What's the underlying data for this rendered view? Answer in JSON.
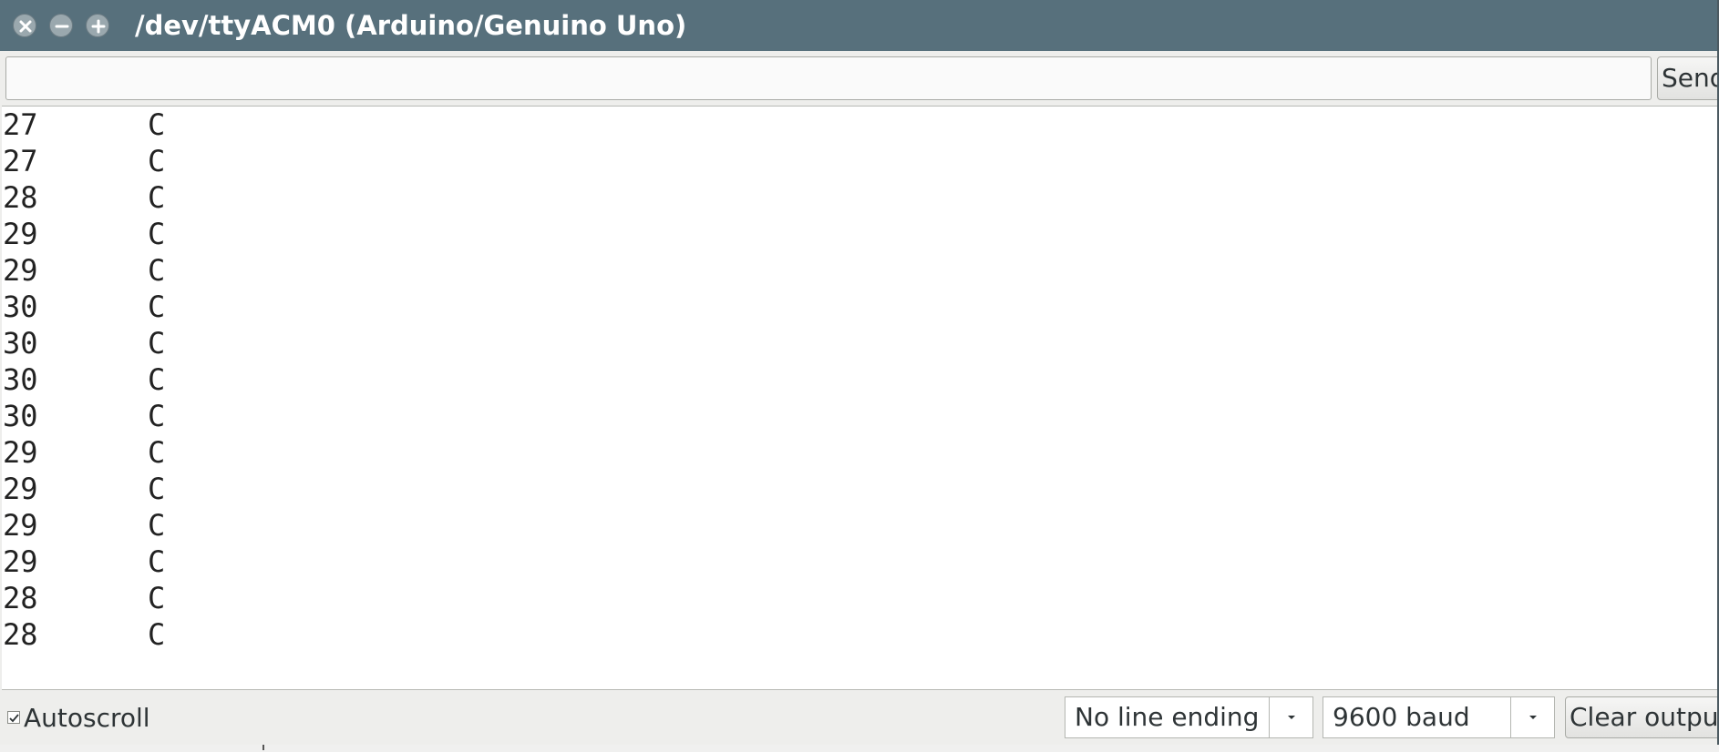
{
  "window": {
    "title": "/dev/ttyACM0 (Arduino/Genuino Uno)",
    "controls": [
      "close-icon",
      "minimize-icon",
      "maximize-icon"
    ],
    "titlebar_color": "#57707c"
  },
  "send_row": {
    "input_value": "",
    "send_label": "Send"
  },
  "output": {
    "lines": [
      {
        "value": "27",
        "unit": "C"
      },
      {
        "value": "27",
        "unit": "C"
      },
      {
        "value": "28",
        "unit": "C"
      },
      {
        "value": "29",
        "unit": "C"
      },
      {
        "value": "29",
        "unit": "C"
      },
      {
        "value": "30",
        "unit": "C"
      },
      {
        "value": "30",
        "unit": "C"
      },
      {
        "value": "30",
        "unit": "C"
      },
      {
        "value": "30",
        "unit": "C"
      },
      {
        "value": "29",
        "unit": "C"
      },
      {
        "value": "29",
        "unit": "C"
      },
      {
        "value": "29",
        "unit": "C"
      },
      {
        "value": "29",
        "unit": "C"
      },
      {
        "value": "28",
        "unit": "C"
      },
      {
        "value": "28",
        "unit": "C"
      }
    ]
  },
  "status": {
    "autoscroll_label": "Autoscroll",
    "autoscroll_checked": true,
    "line_ending": "No line ending",
    "baud": "9600 baud",
    "clear_label": "Clear output"
  }
}
